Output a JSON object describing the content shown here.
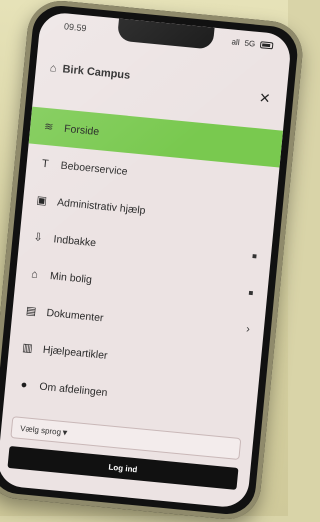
{
  "status": {
    "time": "09.59",
    "signal": "all",
    "network": "5G"
  },
  "header": {
    "title": "Birk Campus",
    "close_label": "×"
  },
  "menu": [
    {
      "label": "Forside",
      "icon": "layers-icon",
      "active": true
    },
    {
      "label": "Beboerservice",
      "icon": "hammer-icon",
      "active": false
    },
    {
      "label": "Administrativ hjælp",
      "icon": "clipboard-icon",
      "active": false
    },
    {
      "label": "Indbakke",
      "icon": "inbox-icon",
      "active": false,
      "locked": true
    },
    {
      "label": "Min bolig",
      "icon": "home-icon",
      "active": false,
      "locked": true
    },
    {
      "label": "Dokumenter",
      "icon": "document-icon",
      "active": false,
      "has_submenu": true
    },
    {
      "label": "Hjælpeartikler",
      "icon": "book-icon",
      "active": false
    },
    {
      "label": "Om afdelingen",
      "icon": "info-icon",
      "active": false
    }
  ],
  "language": {
    "label": "Vælg sprog▼"
  },
  "login": {
    "label": "Log ind"
  },
  "colors": {
    "accent": "#79c94f",
    "background": "#ece3e3",
    "button": "#111111"
  }
}
